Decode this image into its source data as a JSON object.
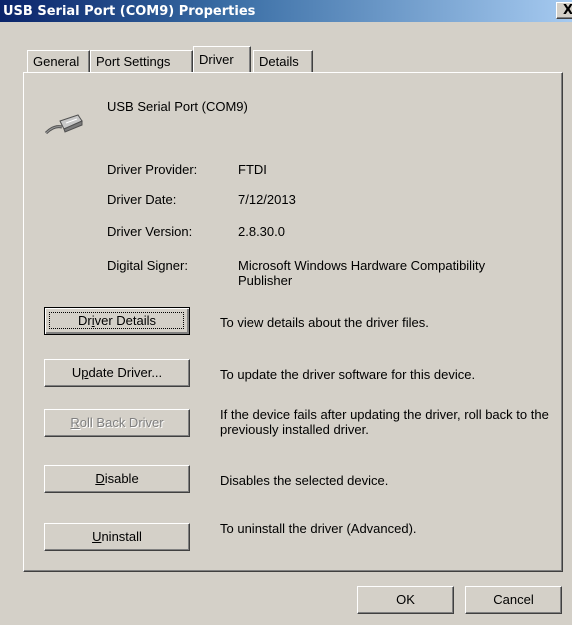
{
  "window": {
    "title": "USB Serial Port (COM9) Properties",
    "close_glyph": "X"
  },
  "tabs": [
    {
      "label": "General",
      "active": false
    },
    {
      "label": "Port Settings",
      "active": false
    },
    {
      "label": "Driver",
      "active": true
    },
    {
      "label": "Details",
      "active": false
    }
  ],
  "device": {
    "name": "USB Serial Port (COM9)",
    "icon": "usb-serial-cable-icon"
  },
  "driver_info": {
    "provider_label": "Driver Provider:",
    "provider_value": "FTDI",
    "date_label": "Driver Date:",
    "date_value": "7/12/2013",
    "version_label": "Driver Version:",
    "version_value": "2.8.30.0",
    "signer_label": "Digital Signer:",
    "signer_value": "Microsoft Windows Hardware Compatibility Publisher"
  },
  "actions": {
    "driver_details": {
      "label_pre": "Dr",
      "label_key": "i",
      "label_post": "ver Details",
      "description": "To view details about the driver files."
    },
    "update_driver": {
      "label_pre": "U",
      "label_key": "p",
      "label_post": "date Driver...",
      "description": "To update the driver software for this device."
    },
    "roll_back": {
      "label_pre": "",
      "label_key": "R",
      "label_post": "oll Back Driver",
      "description": "If the device fails after updating the driver, roll back to the previously installed driver."
    },
    "disable": {
      "label_pre": "",
      "label_key": "D",
      "label_post": "isable",
      "description": "Disables the selected device."
    },
    "uninstall": {
      "label_pre": "",
      "label_key": "U",
      "label_post": "ninstall",
      "description": "To uninstall the driver (Advanced)."
    }
  },
  "footer": {
    "ok_label": "OK",
    "cancel_label": "Cancel"
  }
}
